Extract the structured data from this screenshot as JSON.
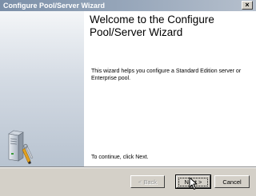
{
  "window": {
    "title": "Configure Pool/Server Wizard",
    "close_glyph": "×"
  },
  "welcome": {
    "heading": "Welcome to the Configure Pool/Server Wizard",
    "intro": "This wizard helps you configure a Standard Edition server or Enterprise pool.",
    "continue": "To continue, click Next."
  },
  "buttons": {
    "back": "< Back",
    "next": "Next >",
    "cancel": "Cancel"
  },
  "icons": {
    "side_graphic": "server-with-tools-icon",
    "pointer": "mouse-pointer-icon"
  },
  "colors": {
    "titlebar": "#7b8fa8",
    "dialog_face": "#d4d0c8",
    "content_background": "#ffffff"
  }
}
